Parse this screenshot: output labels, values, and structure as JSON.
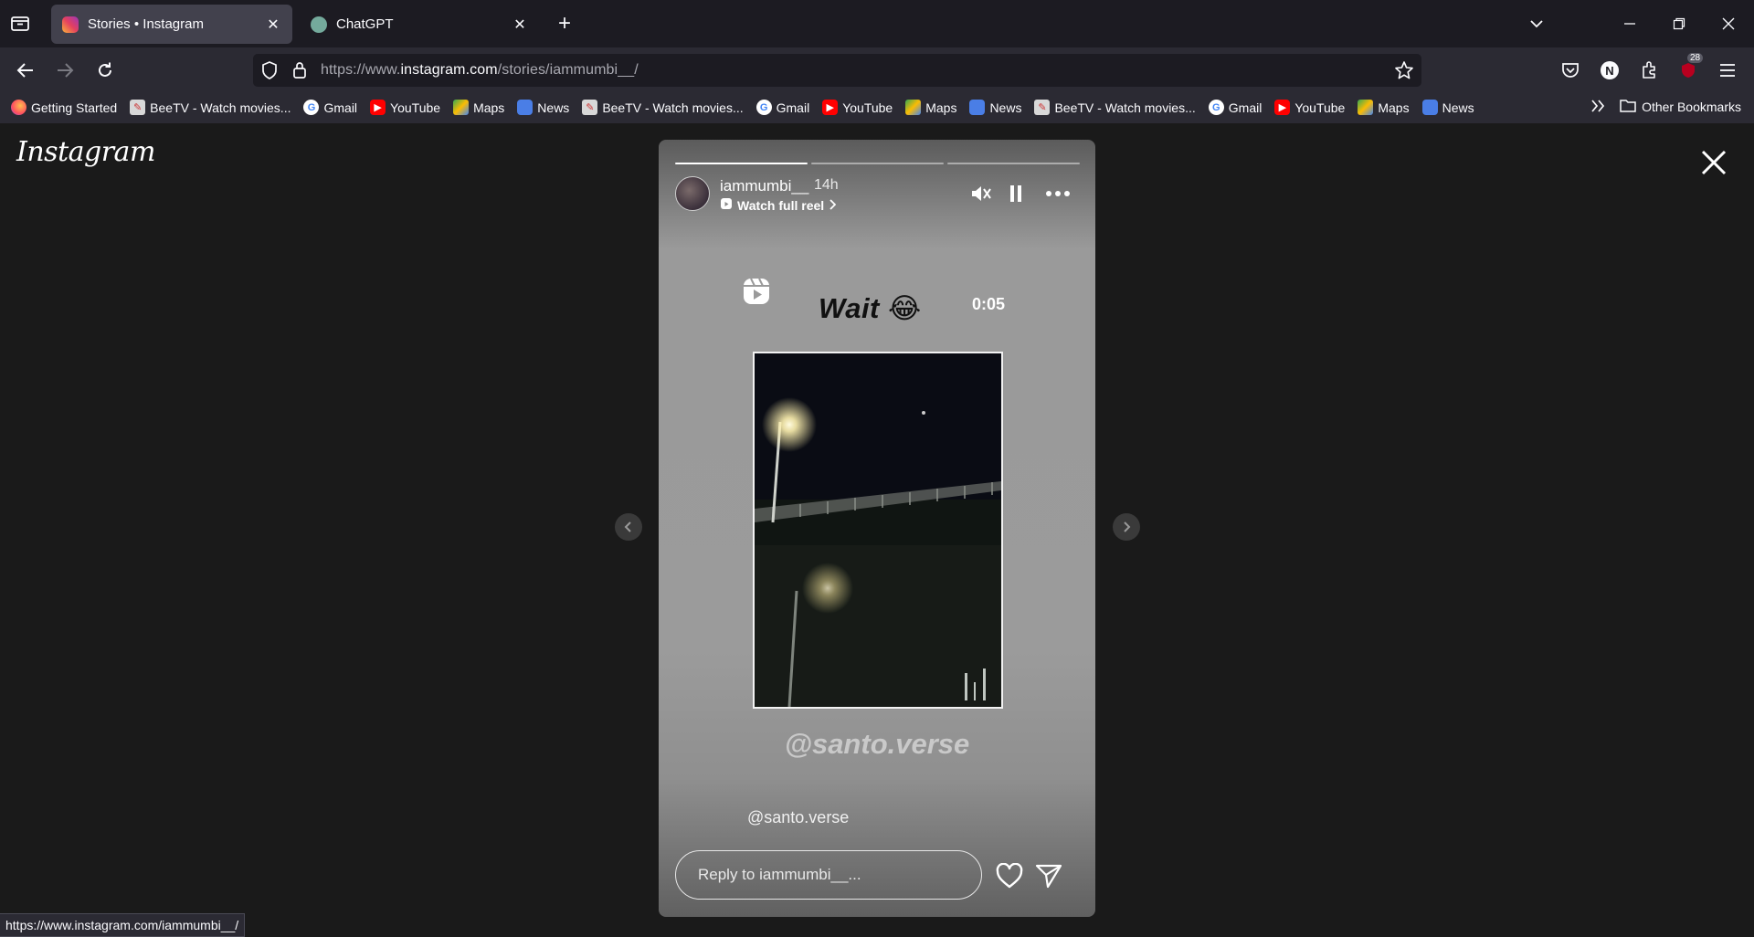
{
  "browser": {
    "tabs": [
      {
        "title": "Stories • Instagram",
        "active": true,
        "icon": "instagram-icon"
      },
      {
        "title": "ChatGPT",
        "active": false,
        "icon": "chatgpt-icon"
      }
    ],
    "url": {
      "prefix": "https://www.",
      "host": "instagram.com",
      "path": "/stories/iammumbi__/"
    },
    "extension_badge": "28",
    "profile_initial": "N",
    "bookmarks": [
      {
        "label": "Getting Started",
        "icon": "firefox-icon"
      },
      {
        "label": "BeeTV - Watch movies...",
        "icon": "beetv-icon"
      },
      {
        "label": "Gmail",
        "icon": "google-icon"
      },
      {
        "label": "YouTube",
        "icon": "youtube-icon"
      },
      {
        "label": "Maps",
        "icon": "maps-icon"
      },
      {
        "label": "News",
        "icon": "news-icon"
      },
      {
        "label": "BeeTV - Watch movies...",
        "icon": "beetv-icon"
      },
      {
        "label": "Gmail",
        "icon": "google-icon"
      },
      {
        "label": "YouTube",
        "icon": "youtube-icon"
      },
      {
        "label": "Maps",
        "icon": "maps-icon"
      },
      {
        "label": "News",
        "icon": "news-icon"
      },
      {
        "label": "BeeTV - Watch movies...",
        "icon": "beetv-icon"
      },
      {
        "label": "Gmail",
        "icon": "google-icon"
      },
      {
        "label": "YouTube",
        "icon": "youtube-icon"
      },
      {
        "label": "Maps",
        "icon": "maps-icon"
      },
      {
        "label": "News",
        "icon": "news-icon"
      }
    ],
    "other_bookmarks": "Other Bookmarks",
    "status_url": "https://www.instagram.com/iammumbi__/"
  },
  "page": {
    "logo": "Instagram",
    "story": {
      "username": "iammumbi__",
      "time_ago": "14h",
      "watch_full_reel": "Watch full reel",
      "progress": [
        1.0,
        0.0,
        0.0
      ],
      "overlay_text": "Wait 😂",
      "duration": "0:05",
      "watermark": "@santo.verse",
      "mention": "@santo.verse",
      "reply_placeholder": "Reply to iammumbi__..."
    }
  },
  "colors": {
    "chrome_dark": "#1c1b22",
    "chrome_mid": "#2b2a33",
    "tab_active": "#42414d",
    "page_bg": "#1a1a1a"
  }
}
